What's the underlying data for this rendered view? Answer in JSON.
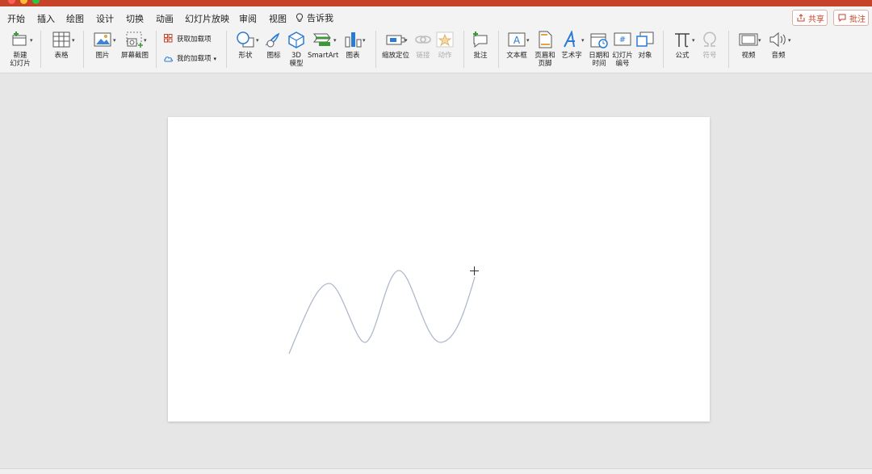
{
  "tabs": [
    {
      "label": "开始",
      "active": false
    },
    {
      "label": "插入",
      "active": true
    },
    {
      "label": "绘图",
      "active": false
    },
    {
      "label": "设计",
      "active": false
    },
    {
      "label": "切换",
      "active": false
    },
    {
      "label": "动画",
      "active": false
    },
    {
      "label": "幻灯片放映",
      "active": false
    },
    {
      "label": "审阅",
      "active": false
    },
    {
      "label": "视图",
      "active": false
    }
  ],
  "tell_me": "告诉我",
  "share_label": "共享",
  "comment_label": "批注",
  "ribbon": {
    "new_slide": [
      "新建",
      "幻灯片"
    ],
    "table": "表格",
    "picture": "图片",
    "screenshot": "屏幕截图",
    "get_addins": "获取加载项",
    "my_addins": "我的加载项",
    "shapes": "形状",
    "icons": "图标",
    "model3d": [
      "3D",
      "模型"
    ],
    "smartart": "SmartArt",
    "chart": "图表",
    "zoom": "缩放定位",
    "link": "链接",
    "action": "动作",
    "comment": "批注",
    "textbox": "文本框",
    "header_footer": [
      "页眉和",
      "页脚"
    ],
    "wordart": "艺术字",
    "datetime": [
      "日期和",
      "时间"
    ],
    "slide_number": [
      "幻灯片",
      "编号"
    ],
    "object": "对象",
    "equation": "公式",
    "symbol": "符号",
    "video": "视频",
    "audio": "音频"
  },
  "colors": {
    "accent": "#c6432a",
    "ribbon_bg": "#f3f3f3",
    "canvas_bg": "#e6e6e6",
    "curve": "#aeb9cc",
    "icon_blue": "#2a7bd4"
  }
}
